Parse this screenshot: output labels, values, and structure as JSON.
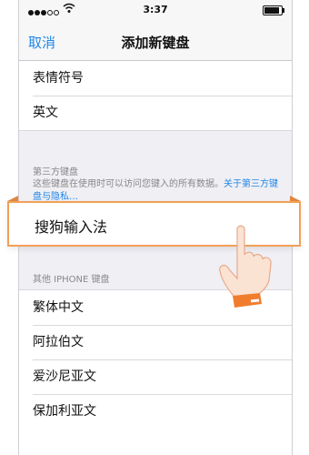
{
  "status_bar": {
    "time": "3:37"
  },
  "nav": {
    "cancel_label": "取消",
    "title": "添加新键盘"
  },
  "languages_top": [
    {
      "label": "表情符号"
    },
    {
      "label": "英文"
    }
  ],
  "third_party": {
    "header": "第三方键盘",
    "description": "这些键盘在使用时可以访问您键入的所有数据。",
    "link_text": "关于第三方键盘与隐私…",
    "keyboard_label": "搜狗输入法"
  },
  "other_iphone": {
    "header": "其他 IPHONE 键盘",
    "items": [
      {
        "label": "繁体中文"
      },
      {
        "label": "阿拉伯文"
      },
      {
        "label": "爱沙尼亚文"
      },
      {
        "label": "保加利亚文"
      }
    ]
  },
  "colors": {
    "accent": "#1f86e8",
    "highlight_border": "#f3a055",
    "cuff": "#f07d2e"
  }
}
